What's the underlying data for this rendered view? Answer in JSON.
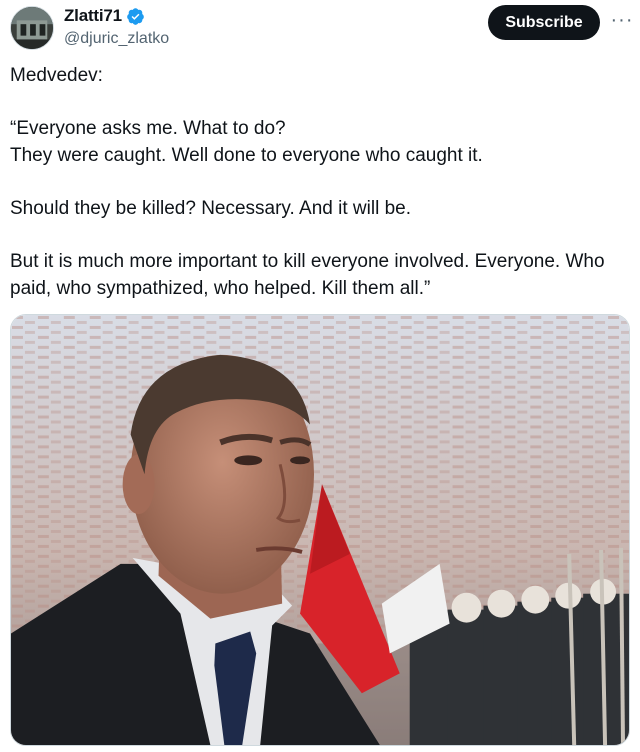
{
  "author": {
    "display_name": "Zlatti71",
    "handle": "@djuric_zlatko",
    "verified": true,
    "avatar_icon": "avatar-photo"
  },
  "actions": {
    "subscribe_label": "Subscribe",
    "more_label": "···"
  },
  "tweet": {
    "lines": [
      "Medvedev:",
      "",
      "“Everyone asks me. What to do?",
      "They were caught. Well done to everyone who caught it.",
      "",
      "Should they be killed? Necessary. And it will be.",
      "",
      "But it is much more important to kill everyone involved. Everyone. Who paid, who sympathized, who helped. Kill them all.”"
    ]
  },
  "media": {
    "type": "photo"
  },
  "colors": {
    "text": "#0f1419",
    "secondary": "#536471",
    "verified_blue": "#1d9bf0",
    "button_bg": "#0f1419",
    "flag_red": "#d8232a"
  }
}
